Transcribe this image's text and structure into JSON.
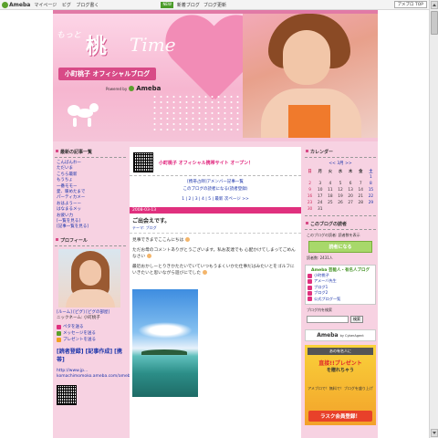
{
  "topbar": {
    "logo": "Ameba",
    "nav": [
      "マイページ",
      "ピグ",
      "ブログ書く"
    ],
    "promo_badge": "NEW",
    "promo": [
      "新着ブログ",
      "ブログ更新"
    ],
    "top_button": "アメブロ TOP"
  },
  "header": {
    "motto": "もっと",
    "title_jp": "桃",
    "title_time": "Time",
    "blog_name": "小町桃子 オフィシャルブログ",
    "powered_by": "Powered by",
    "powered_brand": "Ameba"
  },
  "left": {
    "recent_title": "最新の記事一覧",
    "recent_items": [
      "こんばんわー",
      "ただいま",
      "こちら最新",
      "もうちょ",
      "一番モモー",
      "愛、暖めたまで",
      "パーティカメー",
      "おはようーー",
      "はなまるメッ",
      "お疲い力",
      "[一覧を見る]",
      "[記事一覧を見る]"
    ],
    "profile_title": "プロフィール",
    "profile_links": "[ルーム] [ピグ] [ピグの部屋]",
    "nickname": "ニックネーム: 小町桃子",
    "icon_links": [
      "ペタを送る",
      "メッセージを送る",
      "プレゼントを送る"
    ],
    "reader_link": "[読者登録] [記事作成] [携帯]",
    "url_text": "http://www.jp...",
    "mobile_text": "komachimomoko.ameba.com/ameblo/..."
  },
  "main": {
    "announce": "小町桃子 オフィシャル携帯サイト オープン！",
    "links": [
      "[携帯占師]アメンバー記事一覧",
      "このブログの読者になる(読者登録)"
    ],
    "pager": "1 | 2 | 3 | 4 | 5 | 最新 次ページ >>",
    "entry_date": "2008-03-13",
    "entry_title": "ご出会えです。",
    "entry_theme": "テーマ: ブログ",
    "paragraphs": [
      "見事できまでここんにちは",
      "ただお母のコメントありがとうございます。私お友達でも 心配かけてしまってごめんなさい",
      "最近おかしーとりきかたたいでいていつもうまくいかた仕事だはみたいとをゴルフにいきたいと思いながら遊びにでした"
    ]
  },
  "right": {
    "calendar_title": "カレンダー",
    "calendar_nav": "<< 3月 >>",
    "calendar_head": [
      "日",
      "月",
      "火",
      "水",
      "木",
      "金",
      "土"
    ],
    "calendar_rows": [
      [
        "",
        "",
        "",
        "",
        "",
        "",
        "1"
      ],
      [
        "2",
        "3",
        "4",
        "5",
        "6",
        "7",
        "8"
      ],
      [
        "9",
        "10",
        "11",
        "12",
        "13",
        "14",
        "15"
      ],
      [
        "16",
        "17",
        "18",
        "19",
        "20",
        "21",
        "22"
      ],
      [
        "23",
        "24",
        "25",
        "26",
        "27",
        "28",
        "29"
      ],
      [
        "30",
        "31",
        "",
        "",
        "",
        "",
        ""
      ]
    ],
    "reader_title": "このブログの読者",
    "reader_info": "このブログの読者: 読者数を表示",
    "reader_button": "読者になる",
    "reader_count": "読者数: 2431人",
    "celeb_title": "Ameba 芸能人・有名人ブログ",
    "celeb_items": [
      "小町桃子",
      "アメーバ先生",
      "ブログ1",
      "ブログ2",
      "公式ブログ一覧"
    ],
    "search_label": "ブログ内を検索",
    "search_button": "検索",
    "ameba_bar": "Ameba",
    "ameba_sub": "by CyberAgent",
    "ad_l1": "あの有名人に",
    "ad_l2": "直接!!プレゼント",
    "ad_l3": "を贈れちゃう",
    "ad_l4": "アメブロで！無料で！ブログを盛り上げ",
    "ad_l5": "ラスク会員登録！"
  }
}
